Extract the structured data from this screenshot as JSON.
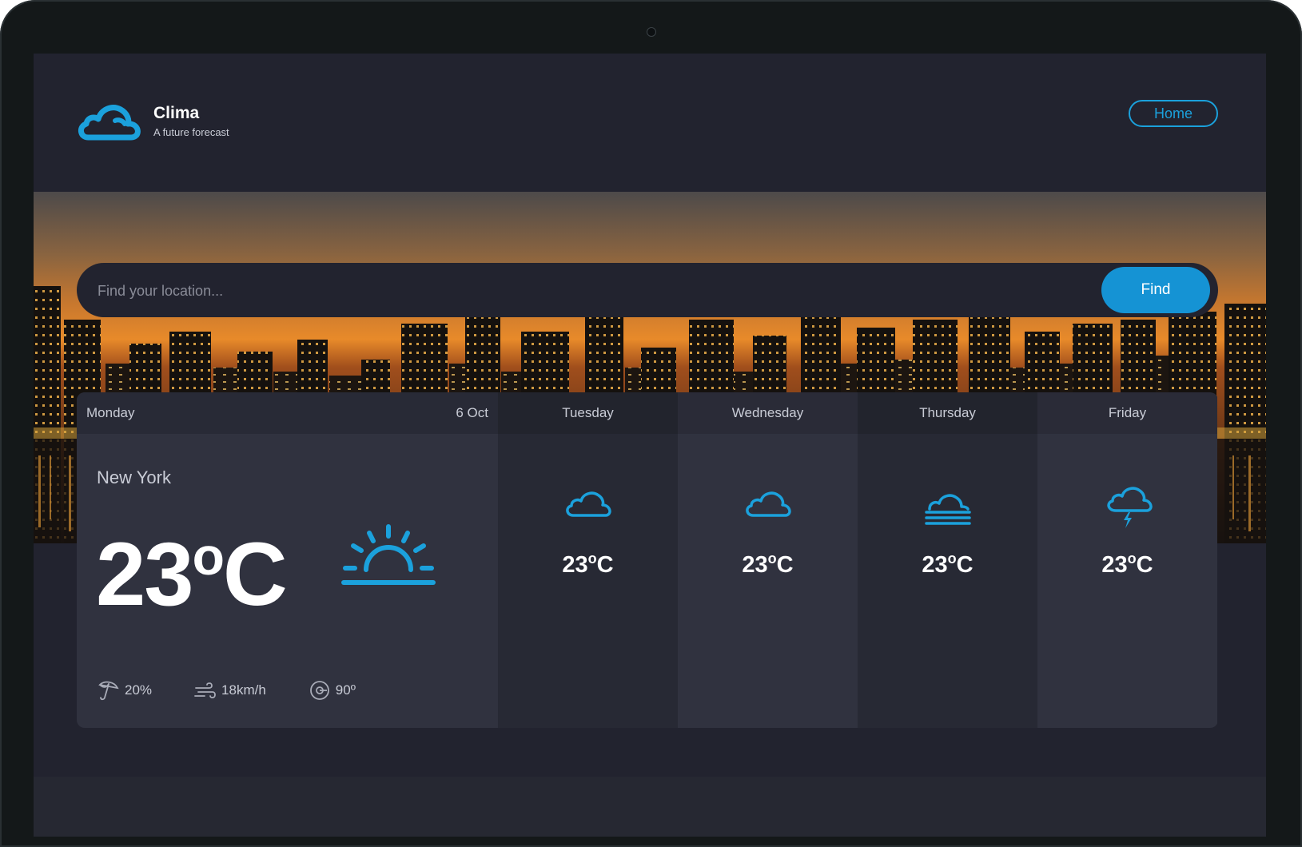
{
  "brand": {
    "name": "Clima",
    "tagline": "A future forecast"
  },
  "nav": {
    "home_label": "Home"
  },
  "search": {
    "placeholder": "Find your location...",
    "button_label": "Find"
  },
  "today": {
    "day": "Monday",
    "date": "6 Oct",
    "location": "New York",
    "temp": "23",
    "unit": "C",
    "degree": "o",
    "icon": "sunrise-icon",
    "stats": {
      "precipitation": "20%",
      "wind": "18km/h",
      "direction": "90º"
    }
  },
  "forecast": [
    {
      "day": "Tuesday",
      "temp": "23",
      "unit": "C",
      "degree": "o",
      "icon": "cloud-icon"
    },
    {
      "day": "Wednesday",
      "temp": "23",
      "unit": "C",
      "degree": "o",
      "icon": "cloud-icon"
    },
    {
      "day": "Thursday",
      "temp": "23",
      "unit": "C",
      "degree": "o",
      "icon": "fog-icon"
    },
    {
      "day": "Friday",
      "temp": "23",
      "unit": "C",
      "degree": "o",
      "icon": "thunderstorm-icon"
    }
  ],
  "colors": {
    "accent": "#1ba1dc",
    "button": "#1593d4",
    "background": "#22232f",
    "panel": "#30323f"
  }
}
